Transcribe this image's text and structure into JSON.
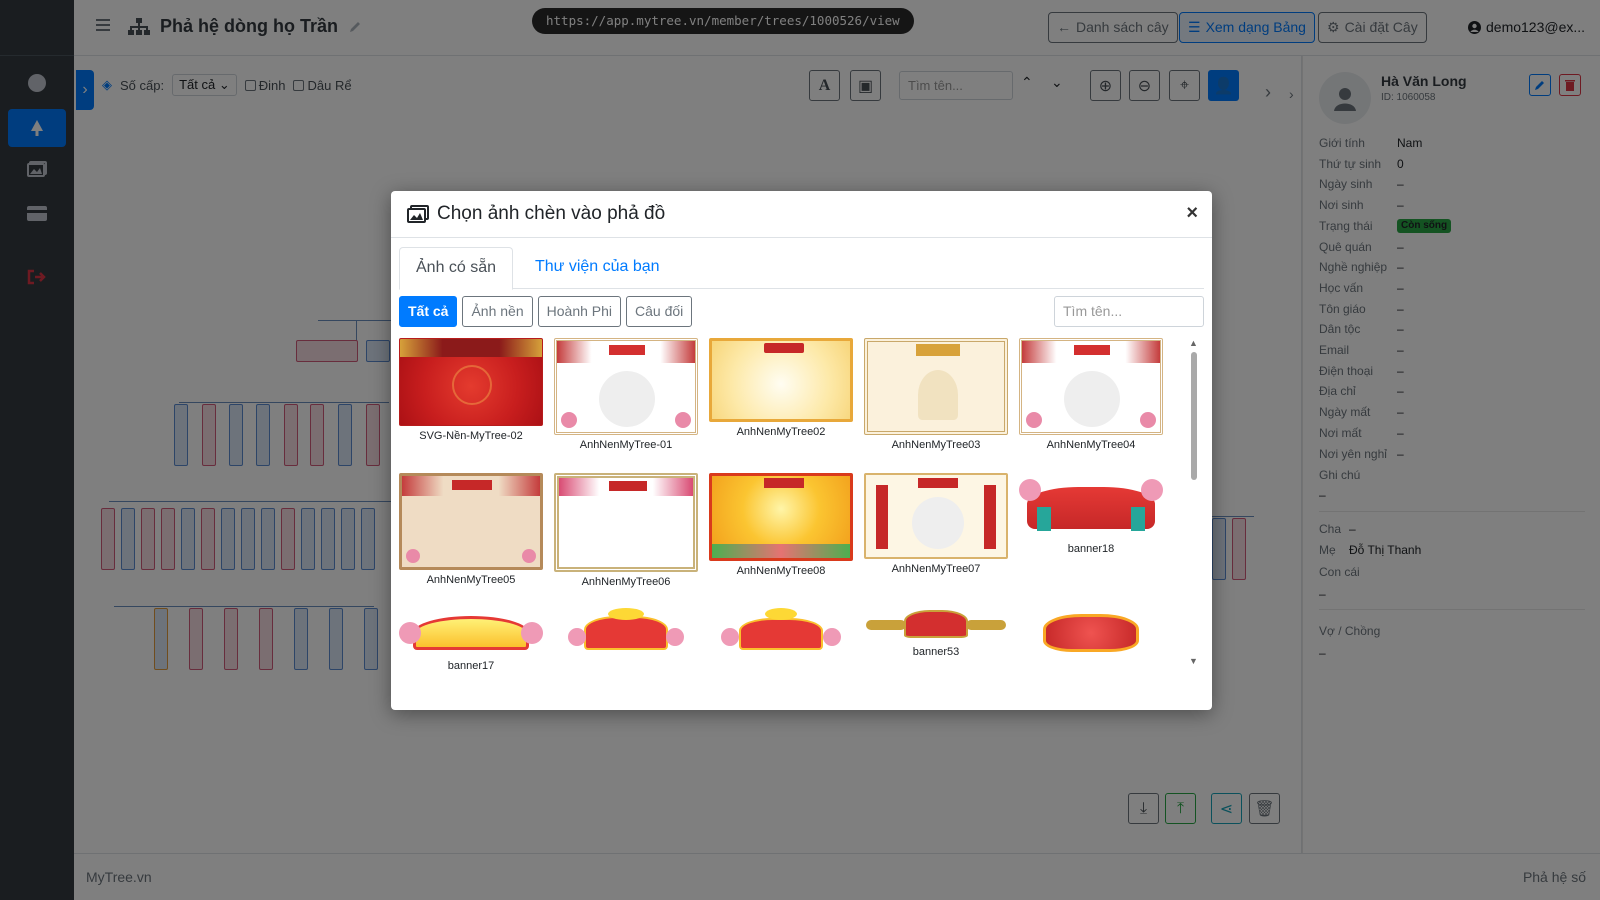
{
  "header": {
    "title": "Phả hệ dòng họ Trần",
    "url": "https://app.mytree.vn/member/trees/1000526/view",
    "btn_list": "Danh sách cây",
    "btn_table": "Xem dạng Bảng",
    "btn_settings": "Cài đặt Cây",
    "user": "demo123@ex..."
  },
  "toolbar": {
    "level_label": "Số cấp:",
    "level_value": "Tất cả",
    "check_pin": "Đinh",
    "check_inlaw": "Dâu Rể",
    "search_placeholder": "Tìm tên..."
  },
  "detail": {
    "name": "Hà Văn Long",
    "id": "ID: 1060058",
    "fields": [
      {
        "k": "Giới tính",
        "v": "Nam"
      },
      {
        "k": "Thứ tự sinh",
        "v": "0"
      },
      {
        "k": "Ngày sinh",
        "v": "–"
      },
      {
        "k": "Nơi sinh",
        "v": "–"
      },
      {
        "k": "Trạng thái",
        "v": "Còn sống"
      },
      {
        "k": "Quê quán",
        "v": "–"
      },
      {
        "k": "Nghề nghiệp",
        "v": "–"
      },
      {
        "k": "Học vấn",
        "v": "–"
      },
      {
        "k": "Tôn giáo",
        "v": "–"
      },
      {
        "k": "Dân tộc",
        "v": "–"
      },
      {
        "k": "Email",
        "v": "–"
      },
      {
        "k": "Điện thoại",
        "v": "–"
      },
      {
        "k": "Địa chỉ",
        "v": "–"
      },
      {
        "k": "Ngày mất",
        "v": "–"
      },
      {
        "k": "Nơi mất",
        "v": "–"
      },
      {
        "k": "Nơi yên nghỉ",
        "v": "–"
      }
    ],
    "note_label": "Ghi chú",
    "note_value": "–",
    "father_label": "Cha",
    "father_value": "–",
    "mother_label": "Mẹ",
    "mother_value": "Đỗ Thị Thanh",
    "children_label": "Con cái",
    "children_value": "–",
    "spouse_label": "Vợ / Chồng",
    "spouse_value": "–"
  },
  "footer": {
    "left": "MyTree.vn",
    "right": "Phả hệ số"
  },
  "modal": {
    "title": "Chọn ảnh chèn vào phả đồ",
    "tabs": [
      "Ảnh có sẵn",
      "Thư viện của bạn"
    ],
    "filters": [
      "Tất cả",
      "Ảnh nền",
      "Hoành Phi",
      "Câu đối"
    ],
    "search_placeholder": "Tìm tên...",
    "images": [
      {
        "name": "SVG-Nền-MyTree-02"
      },
      {
        "name": "AnhNenMyTree-01"
      },
      {
        "name": "AnhNenMyTree02"
      },
      {
        "name": "AnhNenMyTree03"
      },
      {
        "name": "AnhNenMyTree04"
      },
      {
        "name": "AnhNenMyTree05"
      },
      {
        "name": "AnhNenMyTree06"
      },
      {
        "name": "AnhNenMyTree08"
      },
      {
        "name": "AnhNenMyTree07"
      },
      {
        "name": "banner18"
      },
      {
        "name": "banner17"
      },
      {
        "name": ""
      },
      {
        "name": ""
      },
      {
        "name": "banner53"
      },
      {
        "name": ""
      }
    ]
  },
  "colors": {
    "primary": "#007bff",
    "sidebar": "#343a40",
    "danger": "#dc3545",
    "success": "#28a745"
  }
}
